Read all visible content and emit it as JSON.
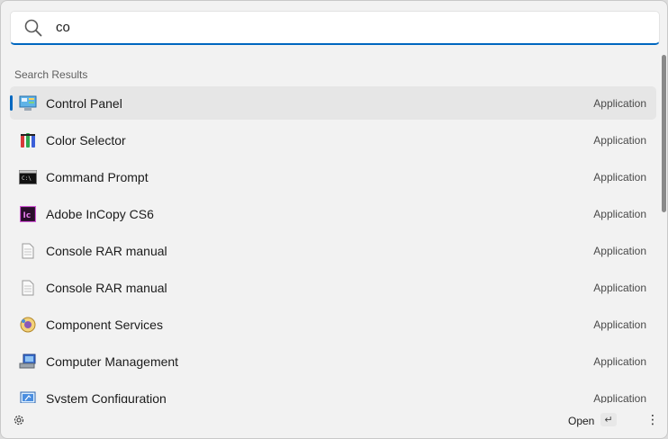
{
  "search": {
    "value": "co",
    "icon": "search-icon"
  },
  "section_title": "Search Results",
  "results": [
    {
      "title": "Control Panel",
      "kind": "Application",
      "icon": "control-panel-icon",
      "selected": true
    },
    {
      "title": "Color Selector",
      "kind": "Application",
      "icon": "color-selector-icon"
    },
    {
      "title": "Command Prompt",
      "kind": "Application",
      "icon": "command-prompt-icon"
    },
    {
      "title": "Adobe InCopy CS6",
      "kind": "Application",
      "icon": "incopy-icon",
      "icon_text": "Ic"
    },
    {
      "title": "Console RAR manual",
      "kind": "Application",
      "icon": "document-icon"
    },
    {
      "title": "Console RAR manual",
      "kind": "Application",
      "icon": "document-icon"
    },
    {
      "title": "Component Services",
      "kind": "Application",
      "icon": "component-services-icon"
    },
    {
      "title": "Computer Management",
      "kind": "Application",
      "icon": "computer-management-icon"
    },
    {
      "title": "System Configuration",
      "kind": "Application",
      "icon": "system-configuration-icon"
    }
  ],
  "footer": {
    "open_label": "Open",
    "enter_key": "↵",
    "more": "⋮"
  },
  "colors": {
    "accent": "#0067c0",
    "background": "#f2f2f2",
    "selected_row": "#e6e6e6"
  }
}
